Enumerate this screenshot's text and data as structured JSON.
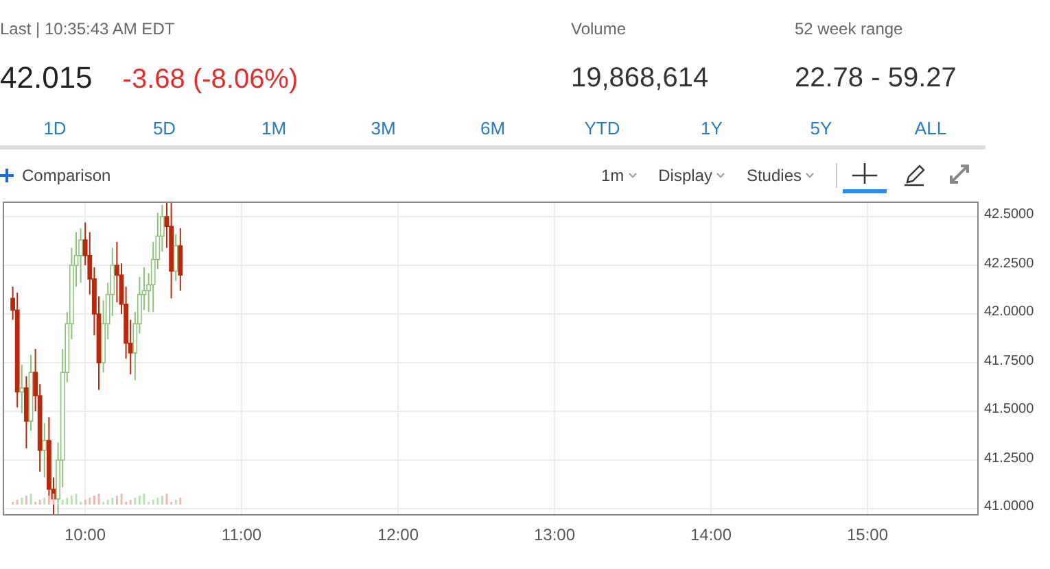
{
  "quote": {
    "timestamp": "Last | 10:35:43 AM EDT",
    "last": "42.015",
    "change": "-3.68 (-8.06%)"
  },
  "stats": [
    {
      "label": "Volume",
      "value": "19,868,614"
    },
    {
      "label": "52 week range",
      "value": "22.78 - 59.27"
    }
  ],
  "ranges": [
    "1D",
    "5D",
    "1M",
    "3M",
    "6M",
    "YTD",
    "1Y",
    "5Y",
    "ALL"
  ],
  "toolbar": {
    "comparison": "Comparison",
    "menus": [
      "1m",
      "Display",
      "Studies"
    ],
    "tools": [
      {
        "kind": "crosshair",
        "selected": true
      },
      {
        "kind": "draw",
        "selected": false
      },
      {
        "kind": "expand",
        "selected": false
      }
    ]
  },
  "chart": {
    "price_axis": [
      "42.5000",
      "42.2500",
      "42.0000",
      "41.7500",
      "41.5000",
      "41.2500",
      "41.0000"
    ],
    "time_axis": [
      "10:00",
      "11:00",
      "12:00",
      "13:00",
      "14:00",
      "15:00"
    ]
  }
}
